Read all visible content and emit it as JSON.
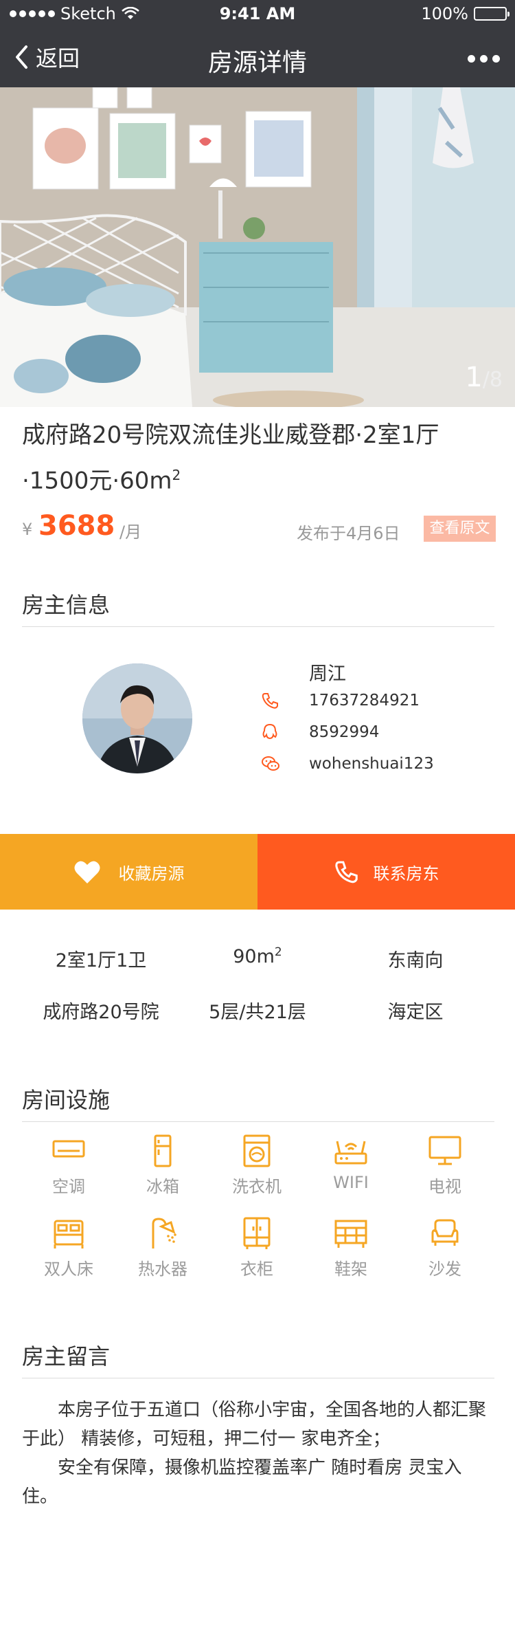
{
  "status_bar": {
    "carrier": "Sketch",
    "time": "9:41 AM",
    "battery": "100%"
  },
  "nav": {
    "back_label": "返回",
    "title": "房源详情"
  },
  "gallery": {
    "current": "1",
    "total": "/8"
  },
  "listing": {
    "title": "成府路20号院双流佳兆业威登郡·2室1厅·1500元·60m",
    "title_sup": "2",
    "currency": "¥",
    "price": "3688",
    "price_unit": "/月",
    "published": "发布于4月6日",
    "view_original": "查看原文"
  },
  "landlord": {
    "section_title": "房主信息",
    "name": "周江",
    "phone": "17637284921",
    "qq": "8592994",
    "wechat": "wohenshuai123"
  },
  "actions": {
    "favorite_label": "收藏房源",
    "contact_label": "联系房东"
  },
  "attributes": {
    "layout": "2室1厅1卫",
    "area": "90m",
    "area_sup": "2",
    "orientation": "东南向",
    "community": "成府路20号院",
    "floor": "5层/共21层",
    "district": "海定区"
  },
  "facilities": {
    "section_title": "房间设施",
    "items": [
      {
        "label": "空调",
        "icon": "air-conditioner-icon"
      },
      {
        "label": "冰箱",
        "icon": "fridge-icon"
      },
      {
        "label": "洗衣机",
        "icon": "washing-machine-icon"
      },
      {
        "label": "WIFI",
        "icon": "wifi-router-icon"
      },
      {
        "label": "电视",
        "icon": "tv-icon"
      },
      {
        "label": "双人床",
        "icon": "double-bed-icon"
      },
      {
        "label": "热水器",
        "icon": "water-heater-icon"
      },
      {
        "label": "衣柜",
        "icon": "wardrobe-icon"
      },
      {
        "label": "鞋架",
        "icon": "shoe-rack-icon"
      },
      {
        "label": "沙发",
        "icon": "sofa-icon"
      }
    ],
    "icon_color": "#f5a623"
  },
  "message": {
    "section_title": "房主留言",
    "para1": "本房子位于五道口（俗称小宇宙，全国各地的人都汇聚于此） 精装修，可短租，押二付一 家电齐全；",
    "para2": "安全有保障，摄像机监控覆盖率广 随时看房 灵宝入住。"
  },
  "colors": {
    "nav_bg": "#393a3f",
    "accent": "#ff5a1f",
    "favorite": "#f5a623",
    "view_original_bg": "#fbb9a4"
  }
}
